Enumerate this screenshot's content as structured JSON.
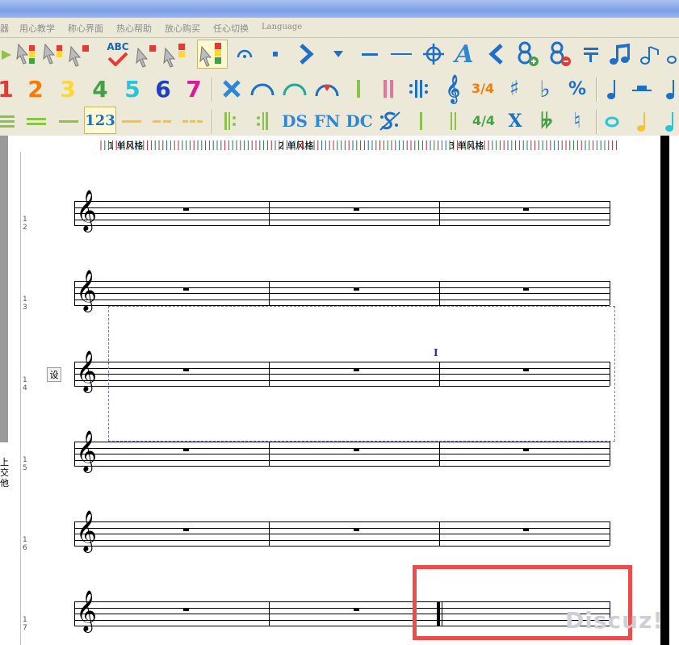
{
  "menu": {
    "items": [
      "器",
      "用心教学",
      "称心界面",
      "热心帮助",
      "放心购买",
      "任心切换",
      "Language"
    ]
  },
  "toolbar2": {
    "numbers": [
      "1",
      "2",
      "3",
      "4",
      "5",
      "6",
      "7"
    ],
    "time_sig": "3/4",
    "percent": "%"
  },
  "toolbar3": {
    "num_mode": "123",
    "ds": "DS",
    "fn": "FN",
    "dc": "DC",
    "x": "X",
    "time_sig": "4/4"
  },
  "toolbar1": {
    "abc": "ABC"
  },
  "ruler": {
    "measures": [
      "1 单风格",
      "2 单风格",
      "3 单风格"
    ]
  },
  "systems": [
    {
      "num": "1\n2"
    },
    {
      "num": "1\n3"
    },
    {
      "num": "1\n4"
    },
    {
      "num": "1\n5"
    },
    {
      "num": "1\n6"
    },
    {
      "num": "1\n7"
    }
  ],
  "set_button": "设",
  "side_text": "上\n交\n他",
  "cursor": "I",
  "watermark": "Discuz!",
  "colors": {
    "highlight": "#ec4c4c",
    "selection": "#7a7ad8",
    "toolbar_bg": "#ece9d8"
  }
}
